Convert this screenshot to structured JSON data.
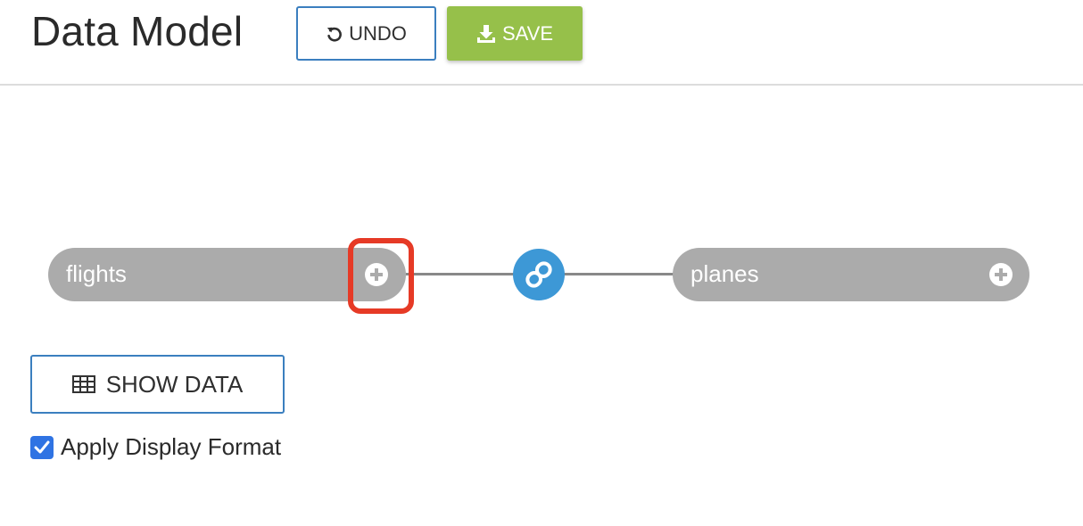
{
  "header": {
    "title": "Data Model",
    "undo_label": "UNDO",
    "save_label": "SAVE"
  },
  "model": {
    "left_table": {
      "label": "flights",
      "add_icon": "plus-circle-icon"
    },
    "join": {
      "icon": "link-icon"
    },
    "right_table": {
      "label": "planes",
      "add_icon": "plus-circle-icon"
    }
  },
  "actions": {
    "show_data_label": "SHOW DATA",
    "show_data_icon": "table-icon",
    "apply_format_label": "Apply Display Format",
    "apply_format_checked": true
  },
  "colors": {
    "accent_blue": "#3b7fbf",
    "save_green": "#96c04a",
    "node_gray": "#ababab",
    "join_blue": "#3d98d6",
    "highlight_red": "#e63a26",
    "checkbox_blue": "#2f73e3"
  }
}
